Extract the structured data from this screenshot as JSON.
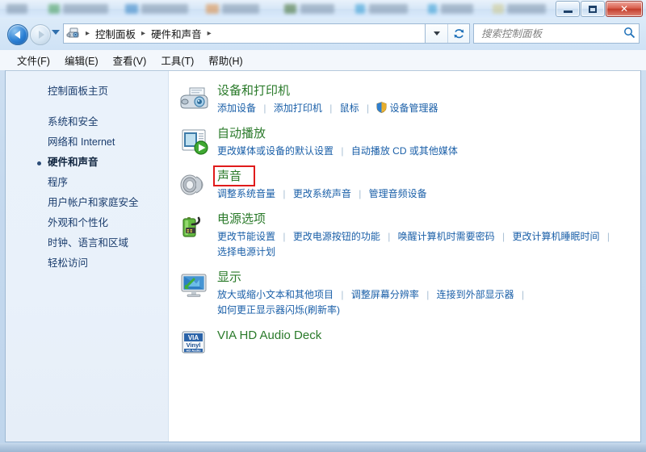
{
  "window": {
    "controls": {
      "minimize_label": "Minimize",
      "maximize_label": "Maximize",
      "close_label": "✕"
    }
  },
  "nav": {
    "back_label": "后退",
    "forward_label": "前进",
    "history_label": "最近访问的位置",
    "chevron_label": "上一个位置",
    "refresh_label": "↻",
    "breadcrumb": [
      {
        "label": "控制面板"
      },
      {
        "label": "硬件和声音"
      }
    ],
    "breadcrumb_separator": "▸"
  },
  "search": {
    "placeholder": "搜索控制面板",
    "value": "",
    "icon": "search-icon"
  },
  "menubar": {
    "items": [
      {
        "label": "文件(F)"
      },
      {
        "label": "编辑(E)"
      },
      {
        "label": "查看(V)"
      },
      {
        "label": "工具(T)"
      },
      {
        "label": "帮助(H)"
      }
    ]
  },
  "sidebar": {
    "home_label": "控制面板主页",
    "items": [
      {
        "label": "系统和安全",
        "current": false
      },
      {
        "label": "网络和 Internet",
        "current": false
      },
      {
        "label": "硬件和声音",
        "current": true
      },
      {
        "label": "程序",
        "current": false
      },
      {
        "label": "用户帐户和家庭安全",
        "current": false
      },
      {
        "label": "外观和个性化",
        "current": false
      },
      {
        "label": "时钟、语言和区域",
        "current": false
      },
      {
        "label": "轻松访问",
        "current": false
      }
    ]
  },
  "main": {
    "categories": [
      {
        "id": "devices-and-printers",
        "icon": "printer-camera-icon",
        "title": "设备和打印机",
        "links": [
          {
            "label": "添加设备",
            "shield": false
          },
          {
            "label": "添加打印机",
            "shield": false
          },
          {
            "label": "鼠标",
            "shield": false
          },
          {
            "label": "设备管理器",
            "shield": true
          }
        ]
      },
      {
        "id": "autoplay",
        "icon": "autoplay-icon",
        "title": "自动播放",
        "links": [
          {
            "label": "更改媒体或设备的默认设置",
            "shield": false
          },
          {
            "label": "自动播放 CD 或其他媒体",
            "shield": false
          }
        ]
      },
      {
        "id": "sound",
        "icon": "speaker-icon",
        "title": "声音",
        "highlighted": true,
        "links": [
          {
            "label": "调整系统音量",
            "shield": false
          },
          {
            "label": "更改系统声音",
            "shield": false
          },
          {
            "label": "管理音频设备",
            "shield": false
          }
        ]
      },
      {
        "id": "power-options",
        "icon": "battery-plug-icon",
        "title": "电源选项",
        "links": [
          {
            "label": "更改节能设置",
            "shield": false
          },
          {
            "label": "更改电源按钮的功能",
            "shield": false
          },
          {
            "label": "唤醒计算机时需要密码",
            "shield": false
          },
          {
            "label": "更改计算机睡眠时间",
            "shield": false
          },
          {
            "label": "选择电源计划",
            "shield": false
          }
        ]
      },
      {
        "id": "display",
        "icon": "monitor-icon",
        "title": "显示",
        "links": [
          {
            "label": "放大或缩小文本和其他项目",
            "shield": false
          },
          {
            "label": "调整屏幕分辨率",
            "shield": false
          },
          {
            "label": "连接到外部显示器",
            "shield": false
          },
          {
            "label": "如何更正显示器闪烁(刷新率)",
            "shield": false
          }
        ]
      },
      {
        "id": "via-hd-audio-deck",
        "icon": "via-vinyl-icon",
        "title": "VIA HD Audio Deck",
        "links": []
      }
    ]
  },
  "colors": {
    "category_title": "#2a7a2a",
    "link": "#1a5fa8",
    "highlight_box": "#e01b1b",
    "sidebar_text": "#1b3d6d"
  }
}
